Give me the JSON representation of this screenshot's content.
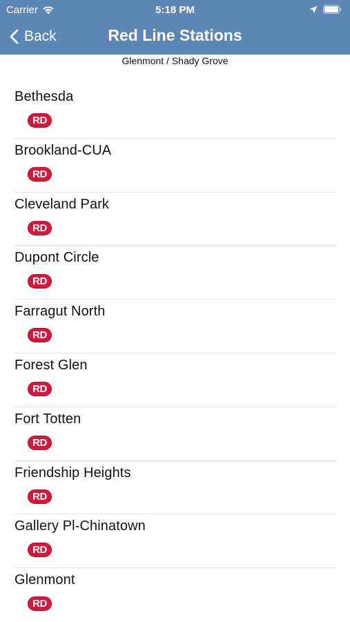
{
  "status_bar": {
    "carrier": "Carrier",
    "time": "5:18 PM"
  },
  "nav": {
    "back_label": "Back",
    "title": "Red Line Stations"
  },
  "subtitle": "Glenmont / Shady Grove",
  "stations": [
    {
      "name": "Bethesda",
      "line": "RD"
    },
    {
      "name": "Brookland-CUA",
      "line": "RD"
    },
    {
      "name": "Cleveland Park",
      "line": "RD"
    },
    {
      "name": "Dupont Circle",
      "line": "RD"
    },
    {
      "name": "Farragut North",
      "line": "RD"
    },
    {
      "name": "Forest Glen",
      "line": "RD"
    },
    {
      "name": "Fort Totten",
      "line": "RD"
    },
    {
      "name": "Friendship Heights",
      "line": "RD"
    },
    {
      "name": "Gallery Pl-Chinatown",
      "line": "RD"
    },
    {
      "name": "Glenmont",
      "line": "RD"
    }
  ],
  "colors": {
    "nav_bar": "#5c86b4",
    "red_line": "#d6163a"
  }
}
